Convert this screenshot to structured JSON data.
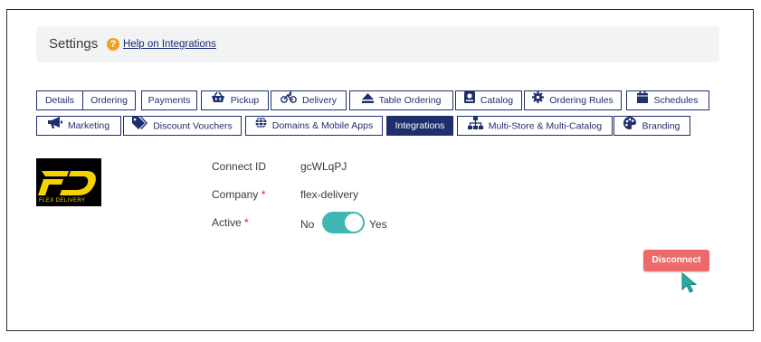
{
  "header": {
    "title": "Settings",
    "help_icon": "?",
    "help_link": "Help on Integrations"
  },
  "tabs_row1": [
    {
      "label": "Details",
      "icon": null
    },
    {
      "label": "Ordering",
      "icon": null
    },
    {
      "label": "Payments",
      "icon": null
    },
    {
      "label": "Pickup",
      "icon": "shopping-basket-icon"
    },
    {
      "label": "Delivery",
      "icon": "bicycle-icon"
    },
    {
      "label": "Table Ordering",
      "icon": "eject-icon"
    },
    {
      "label": "Catalog",
      "icon": "catalog-icon"
    },
    {
      "label": "Ordering Rules",
      "icon": "gear-icon"
    },
    {
      "label": "Schedules",
      "icon": "calendar-icon"
    }
  ],
  "tabs_row2": [
    {
      "label": "Marketing",
      "icon": "megaphone-icon"
    },
    {
      "label": "Discount Vouchers",
      "icon": "tags-icon"
    },
    {
      "label": "Domains & Mobile Apps",
      "icon": "globe-icon"
    },
    {
      "label": "Integrations",
      "icon": null,
      "active": true
    },
    {
      "label": "Multi-Store & Multi-Catalog",
      "icon": "sitemap-icon"
    },
    {
      "label": "Branding",
      "icon": "palette-icon"
    }
  ],
  "integration": {
    "logo_text": "FLEX DELIVERY",
    "connect_id_label": "Connect ID",
    "connect_id_value": "gcWLqPJ",
    "company_label": "Company",
    "company_value": "flex-delivery",
    "active_label": "Active",
    "required_mark": "*",
    "toggle_off_label": "No",
    "toggle_on_label": "Yes",
    "active": true,
    "disconnect_label": "Disconnect"
  },
  "colors": {
    "navy": "#1f2f6c",
    "toggle_on": "#3fb6b4",
    "disconnect": "#ec6a6a",
    "help": "#f0a020",
    "logo_yellow": "#f5d100"
  }
}
